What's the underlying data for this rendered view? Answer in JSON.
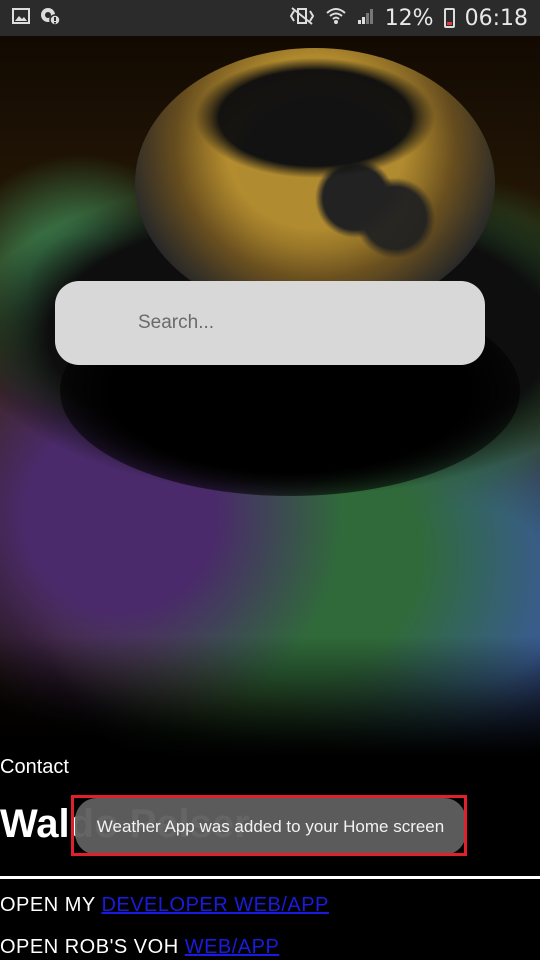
{
  "status_bar": {
    "left_icons": [
      "image-icon",
      "settings-gear-icon"
    ],
    "right_icons": [
      "vibrate-mute-icon",
      "wifi-icon",
      "signal-icon"
    ],
    "battery_percent": "12%",
    "time": "06:18",
    "battery_icon": "battery-low-icon"
  },
  "search": {
    "placeholder": "Search..."
  },
  "contact": {
    "label": "Contact",
    "name": "Waldo Pelser"
  },
  "links": [
    {
      "prefix": "OPEN MY ",
      "link_text": "DEVELOPER WEB/APP"
    },
    {
      "prefix": "OPEN ROB'S VOH ",
      "link_text": "WEB/APP"
    }
  ],
  "toast": {
    "message": "Weather App was added to your Home screen"
  },
  "colors": {
    "status_bar_bg": "#2b2b2b",
    "link": "#1a1ae0",
    "toast_bg": "#5f5f5f",
    "highlight": "#e0202c"
  }
}
